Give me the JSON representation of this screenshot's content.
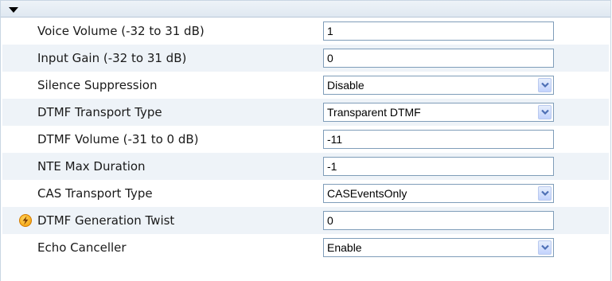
{
  "rows": [
    {
      "label": "Voice Volume (-32 to 31 dB)",
      "type": "input",
      "value": "1"
    },
    {
      "label": "Input Gain (-32 to 31 dB)",
      "type": "input",
      "value": "0"
    },
    {
      "label": "Silence Suppression",
      "type": "select",
      "value": "Disable"
    },
    {
      "label": "DTMF Transport Type",
      "type": "select",
      "value": "Transparent DTMF"
    },
    {
      "label": "DTMF Volume (-31 to 0 dB)",
      "type": "input",
      "value": "-11"
    },
    {
      "label": "NTE Max Duration",
      "type": "input",
      "value": "-1"
    },
    {
      "label": "CAS Transport Type",
      "type": "select",
      "value": "CASEventsOnly"
    },
    {
      "label": "DTMF Generation Twist",
      "type": "input",
      "value": "0",
      "icon": "lightning-bolt-icon"
    },
    {
      "label": "Echo Canceller",
      "type": "select",
      "value": "Enable"
    }
  ],
  "header": {
    "icon": "collapse-caret-icon"
  },
  "colors": {
    "row_alt": "#eef3f8",
    "border": "#7f9db9",
    "arrow_fill": "#4d6fb5",
    "warn": "#f49a00"
  }
}
